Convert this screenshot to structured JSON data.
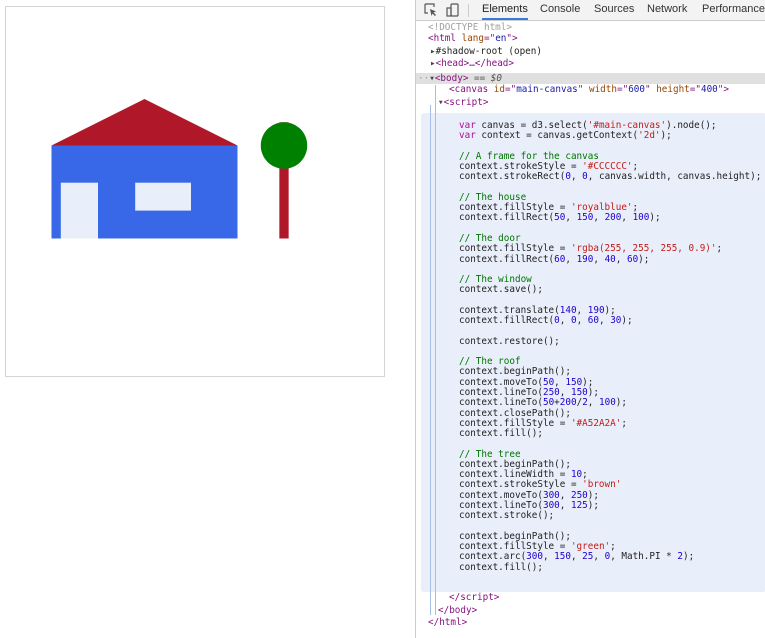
{
  "canvas_drawing": {
    "frame_color": "#CCCCCC",
    "house_color": "#3868E8",
    "door_color": "#E9EFFA",
    "roof_color": "#B0182A",
    "trunk_color": "#B0182A",
    "foliage_color": "#008000"
  },
  "devtools": {
    "toolbar": {
      "icons": [
        "inspect-element-icon",
        "device-toolbar-icon"
      ],
      "tabs": [
        "Elements",
        "Console",
        "Sources",
        "Network",
        "Performance"
      ],
      "active_tab": "Elements",
      "accent": "#3879D9"
    },
    "dom": {
      "doctype": "<!DOCTYPE html>",
      "html_open": [
        "<",
        "html",
        " lang",
        "=\"",
        "en",
        "\">"
      ],
      "shadow_root": "#shadow-root (open)",
      "head": [
        "<",
        "head",
        ">…</",
        "head",
        ">"
      ],
      "body_open": [
        "<",
        "body",
        ">"
      ],
      "body_selected_marker": " == $0",
      "canvas": [
        "<",
        "canvas",
        " id",
        "=\"",
        "main-canvas",
        "\"",
        " width",
        "=\"",
        "600",
        "\"",
        " height",
        "=\"",
        "400",
        "\">"
      ],
      "script_open": [
        "<",
        "script",
        ">"
      ],
      "script_close": [
        "</",
        "script",
        ">"
      ],
      "body_close": [
        "</",
        "body",
        ">"
      ],
      "html_close": [
        "</",
        "html",
        ">"
      ]
    },
    "code_lines": [
      [
        [
          "kw",
          "var"
        ],
        [
          "pl",
          " canvas = d3.select("
        ],
        [
          "str",
          "'#main-canvas'"
        ],
        [
          "pl",
          ").node();"
        ]
      ],
      [
        [
          "kw",
          "var"
        ],
        [
          "pl",
          " context = canvas.getContext("
        ],
        [
          "str",
          "'2d'"
        ],
        [
          "pl",
          ");"
        ]
      ],
      [],
      [
        [
          "cm",
          "// A frame for the canvas"
        ]
      ],
      [
        [
          "pl",
          "context.strokeStyle = "
        ],
        [
          "str",
          "'#CCCCCC'"
        ],
        [
          "pl",
          ";"
        ]
      ],
      [
        [
          "pl",
          "context.strokeRect("
        ],
        [
          "num",
          "0"
        ],
        [
          "pl",
          ", "
        ],
        [
          "num",
          "0"
        ],
        [
          "pl",
          ", canvas.width, canvas.height);"
        ]
      ],
      [],
      [
        [
          "cm",
          "// The house"
        ]
      ],
      [
        [
          "pl",
          "context.fillStyle = "
        ],
        [
          "str",
          "'royalblue'"
        ],
        [
          "pl",
          ";"
        ]
      ],
      [
        [
          "pl",
          "context.fillRect("
        ],
        [
          "num",
          "50"
        ],
        [
          "pl",
          ", "
        ],
        [
          "num",
          "150"
        ],
        [
          "pl",
          ", "
        ],
        [
          "num",
          "200"
        ],
        [
          "pl",
          ", "
        ],
        [
          "num",
          "100"
        ],
        [
          "pl",
          ");"
        ]
      ],
      [],
      [
        [
          "cm",
          "// The door"
        ]
      ],
      [
        [
          "pl",
          "context.fillStyle = "
        ],
        [
          "str",
          "'rgba(255, 255, 255, 0.9)'"
        ],
        [
          "pl",
          ";"
        ]
      ],
      [
        [
          "pl",
          "context.fillRect("
        ],
        [
          "num",
          "60"
        ],
        [
          "pl",
          ", "
        ],
        [
          "num",
          "190"
        ],
        [
          "pl",
          ", "
        ],
        [
          "num",
          "40"
        ],
        [
          "pl",
          ", "
        ],
        [
          "num",
          "60"
        ],
        [
          "pl",
          ");"
        ]
      ],
      [],
      [
        [
          "cm",
          "// The window"
        ]
      ],
      [
        [
          "pl",
          "context.save();"
        ]
      ],
      [],
      [
        [
          "pl",
          "context.translate("
        ],
        [
          "num",
          "140"
        ],
        [
          "pl",
          ", "
        ],
        [
          "num",
          "190"
        ],
        [
          "pl",
          ");"
        ]
      ],
      [
        [
          "pl",
          "context.fillRect("
        ],
        [
          "num",
          "0"
        ],
        [
          "pl",
          ", "
        ],
        [
          "num",
          "0"
        ],
        [
          "pl",
          ", "
        ],
        [
          "num",
          "60"
        ],
        [
          "pl",
          ", "
        ],
        [
          "num",
          "30"
        ],
        [
          "pl",
          ");"
        ]
      ],
      [],
      [
        [
          "pl",
          "context.restore();"
        ]
      ],
      [],
      [
        [
          "cm",
          "// The roof"
        ]
      ],
      [
        [
          "pl",
          "context.beginPath();"
        ]
      ],
      [
        [
          "pl",
          "context.moveTo("
        ],
        [
          "num",
          "50"
        ],
        [
          "pl",
          ", "
        ],
        [
          "num",
          "150"
        ],
        [
          "pl",
          ");"
        ]
      ],
      [
        [
          "pl",
          "context.lineTo("
        ],
        [
          "num",
          "250"
        ],
        [
          "pl",
          ", "
        ],
        [
          "num",
          "150"
        ],
        [
          "pl",
          ");"
        ]
      ],
      [
        [
          "pl",
          "context.lineTo("
        ],
        [
          "num",
          "50"
        ],
        [
          "pl",
          "+"
        ],
        [
          "num",
          "200"
        ],
        [
          "pl",
          "/"
        ],
        [
          "num",
          "2"
        ],
        [
          "pl",
          ", "
        ],
        [
          "num",
          "100"
        ],
        [
          "pl",
          ");"
        ]
      ],
      [
        [
          "pl",
          "context.closePath();"
        ]
      ],
      [
        [
          "pl",
          "context.fillStyle = "
        ],
        [
          "str",
          "'#A52A2A'"
        ],
        [
          "pl",
          ";"
        ]
      ],
      [
        [
          "pl",
          "context.fill();"
        ]
      ],
      [],
      [
        [
          "cm",
          "// The tree"
        ]
      ],
      [
        [
          "pl",
          "context.beginPath();"
        ]
      ],
      [
        [
          "pl",
          "context.lineWidth = "
        ],
        [
          "num",
          "10"
        ],
        [
          "pl",
          ";"
        ]
      ],
      [
        [
          "pl",
          "context.strokeStyle = "
        ],
        [
          "str",
          "'brown'"
        ]
      ],
      [
        [
          "pl",
          "context.moveTo("
        ],
        [
          "num",
          "300"
        ],
        [
          "pl",
          ", "
        ],
        [
          "num",
          "250"
        ],
        [
          "pl",
          ");"
        ]
      ],
      [
        [
          "pl",
          "context.lineTo("
        ],
        [
          "num",
          "300"
        ],
        [
          "pl",
          ", "
        ],
        [
          "num",
          "125"
        ],
        [
          "pl",
          ");"
        ]
      ],
      [
        [
          "pl",
          "context.stroke();"
        ]
      ],
      [],
      [
        [
          "pl",
          "context.beginPath();"
        ]
      ],
      [
        [
          "pl",
          "context.fillStyle = "
        ],
        [
          "str",
          "'green'"
        ],
        [
          "pl",
          ";"
        ]
      ],
      [
        [
          "pl",
          "context.arc("
        ],
        [
          "num",
          "300"
        ],
        [
          "pl",
          ", "
        ],
        [
          "num",
          "150"
        ],
        [
          "pl",
          ", "
        ],
        [
          "num",
          "25"
        ],
        [
          "pl",
          ", "
        ],
        [
          "num",
          "0"
        ],
        [
          "pl",
          ", Math.PI * "
        ],
        [
          "num",
          "2"
        ],
        [
          "pl",
          ");"
        ]
      ],
      [
        [
          "pl",
          "context.fill();"
        ]
      ]
    ]
  }
}
